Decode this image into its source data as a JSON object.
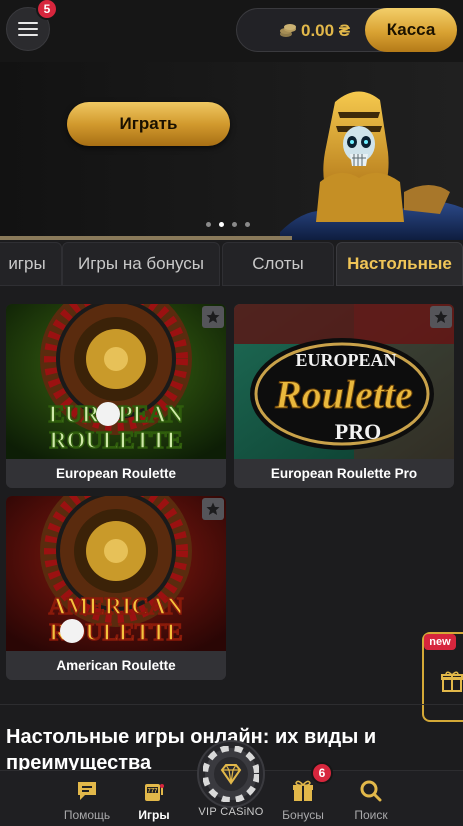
{
  "header": {
    "menu_badge": "5",
    "balance": "0.00 ₴",
    "kassa_label": "Касса"
  },
  "banner": {
    "play_label": "Играть",
    "slides": 4,
    "active_slide": 2
  },
  "tabs": [
    {
      "label": "игры"
    },
    {
      "label": "Игры на бонусы"
    },
    {
      "label": "Слоты"
    },
    {
      "label": "Настольные",
      "active": true
    }
  ],
  "games": [
    {
      "title": "European Roulette",
      "art_line1": "EUROPEAN",
      "art_line2": "ROULETTE"
    },
    {
      "title": "European Roulette Pro",
      "art_line1": "EUROPEAN",
      "art_line2": "Roulette",
      "art_line3": "PRO"
    },
    {
      "title": "American Roulette",
      "art_line1": "AMERICAN",
      "art_line2": "ROULETTE"
    }
  ],
  "gift_tab": {
    "new_label": "new"
  },
  "section": {
    "title": "Настольные игры онлайн: их виды и преимущества"
  },
  "bottom_nav": {
    "help": "Помощь",
    "games": "Игры",
    "vip": "VIP CASiNO",
    "bonuses": "Бонусы",
    "bonuses_badge": "6",
    "search": "Поиск"
  },
  "colors": {
    "accent_gold": "#e2b84a",
    "badge_red": "#d7263d",
    "background": "#1c1c1e"
  }
}
